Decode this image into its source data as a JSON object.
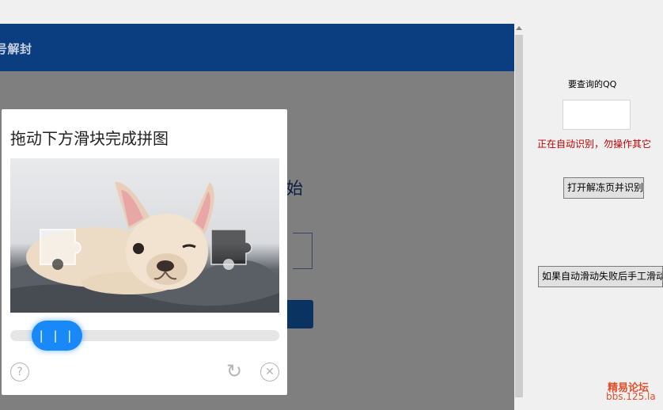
{
  "webpage": {
    "topbar_title": "号解封",
    "heading_fragment": "始"
  },
  "captcha": {
    "title": "拖动下方滑块完成拼图",
    "handle_glyph": "| | |",
    "help_icon": "question-circle-icon",
    "refresh_icon": "refresh-icon",
    "close_icon": "close-circle-icon",
    "slider_color": "#1989fa"
  },
  "panel": {
    "qq_label": "要查询的QQ",
    "qq_value": "",
    "status_text": "正在自动识别，勿操作其它",
    "open_button": "打开解冻页并识别",
    "manual_button": "如果自动滑动失败后手工滑动"
  },
  "watermark": {
    "line1": "精易论坛",
    "line2": "bbs.125.la"
  },
  "colors": {
    "topbar": "#0b3e80",
    "status": "#c00000",
    "watermark": "#e04e2a"
  }
}
